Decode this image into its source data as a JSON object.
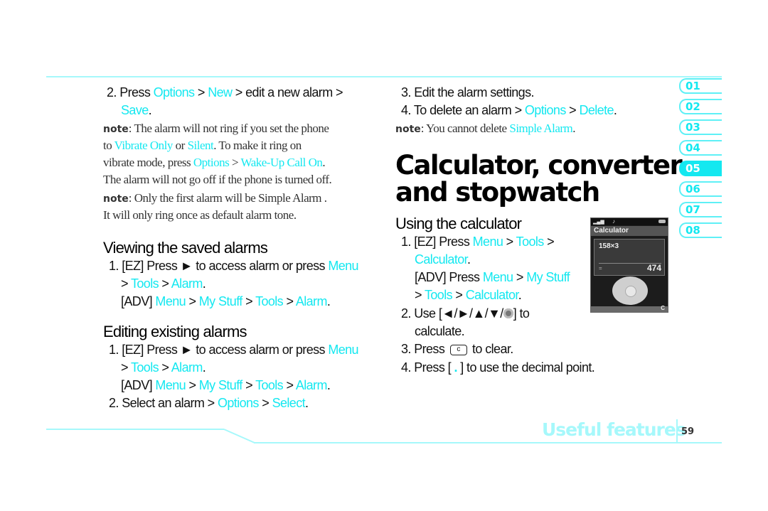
{
  "left_column": {
    "step2": {
      "prefix": "2. Press ",
      "options": "Options",
      "sep1": " > ",
      "new": "New",
      "mid": " > edit a new alarm >",
      "save": "Save",
      "end": "."
    },
    "note1": {
      "label": "note",
      "lines": [
        ": The alarm will not ring if you set the phone",
        "to ",
        "Vibrate Only",
        " or ",
        "Silent",
        ". To make it ring on",
        "vibrate mode, press ",
        "Options",
        " > ",
        "Wake-Up Call On",
        ".",
        "The alarm will not go off if the phone is turned off."
      ]
    },
    "note2": {
      "label": "note",
      "line1": ": Only the first alarm will be Simple Alarm .",
      "line2": "It will only ring once as default alarm tone."
    },
    "viewing": {
      "heading": "Viewing the saved alarms",
      "step1_prefix": "1.  [EZ] Press ► to access alarm or press ",
      "menu": "Menu",
      "gt": " > ",
      "tools": "Tools",
      "alarm": "Alarm",
      "dot": ".",
      "adv": "[ADV] ",
      "mystuff": "My Stuff"
    },
    "editing": {
      "heading": "Editing existing alarms",
      "step2_prefix": "2. Select an alarm > ",
      "options": "Options",
      "select": "Select"
    }
  },
  "mid_column": {
    "step3": "3. Edit the alarm settings.",
    "step4_prefix": "4. To delete an alarm > ",
    "options": "Options",
    "delete": "Delete",
    "note_label": "note",
    "note_text": ": You cannot delete ",
    "simple_alarm": "Simple Alarm",
    "title_line1": "Calculator, converter",
    "title_line2": "and stopwatch",
    "calc_heading": "Using the calculator",
    "calc_step1_prefix": "1. [EZ] Press ",
    "menu": "Menu",
    "gt": " > ",
    "tools": "Tools",
    "calculator": "Calculator",
    "dot": ".",
    "adv_prefix": "[ADV] Press ",
    "mystuff": "My Stuff",
    "calc_step2_prefix": "2. Use [◄/►/▲/▼/",
    "calc_step2_suffix": "] to",
    "calc_step2_line2": "calculate.",
    "calc_step3_prefix": "3. Press ",
    "calc_step3_key": "c",
    "calc_step3_suffix": " to clear.",
    "calc_step4_prefix": "4. Press [ ",
    "calc_step4_key": ".",
    "calc_step4_suffix": " ] to use the decimal point."
  },
  "phone_screen": {
    "title": "Calculator",
    "expression": "158×3",
    "equals": "=",
    "result": "474",
    "softkey_right": "C"
  },
  "chapter_tabs": [
    {
      "label": "01",
      "active": false
    },
    {
      "label": "02",
      "active": false
    },
    {
      "label": "03",
      "active": false
    },
    {
      "label": "04",
      "active": false
    },
    {
      "label": "05",
      "active": true
    },
    {
      "label": "06",
      "active": false
    },
    {
      "label": "07",
      "active": false
    },
    {
      "label": "08",
      "active": false
    }
  ],
  "footer": {
    "section": "Useful features",
    "page_number": "59"
  },
  "colors": {
    "highlight": "#14e8f0",
    "rule": "#a6f8fb",
    "footer_text": "#a6f8fb"
  }
}
